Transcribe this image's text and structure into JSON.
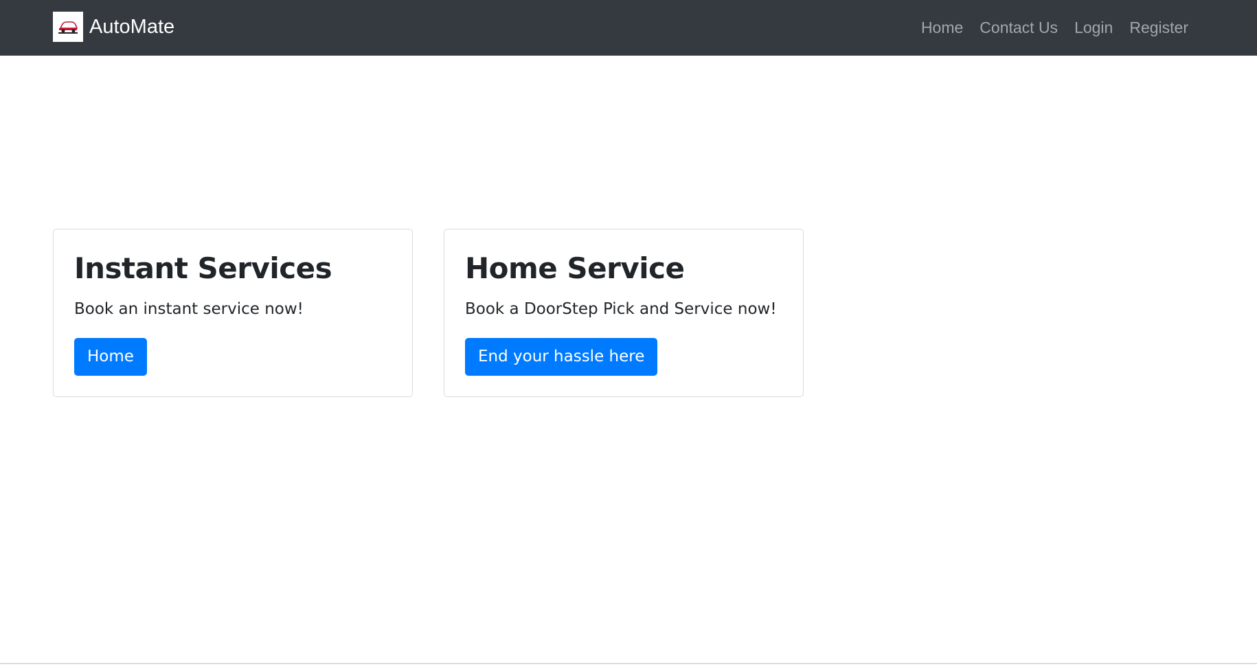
{
  "navbar": {
    "brand_name": "AutoMate",
    "links": [
      "Home",
      "Contact Us",
      "Login",
      "Register"
    ]
  },
  "cards": [
    {
      "title": "Instant Services",
      "text": "Book an instant service now!",
      "button_label": "Home"
    },
    {
      "title": "Home Service",
      "text": "Book a DoorStep Pick and Service now!",
      "button_label": "End your hassle here"
    }
  ],
  "colors": {
    "navbar_bg": "#343a40",
    "primary": "#007bff",
    "text": "#212529",
    "nav_link": "rgba(255,255,255,0.55)"
  },
  "icons": {
    "brand_logo": "car-logo-icon"
  }
}
